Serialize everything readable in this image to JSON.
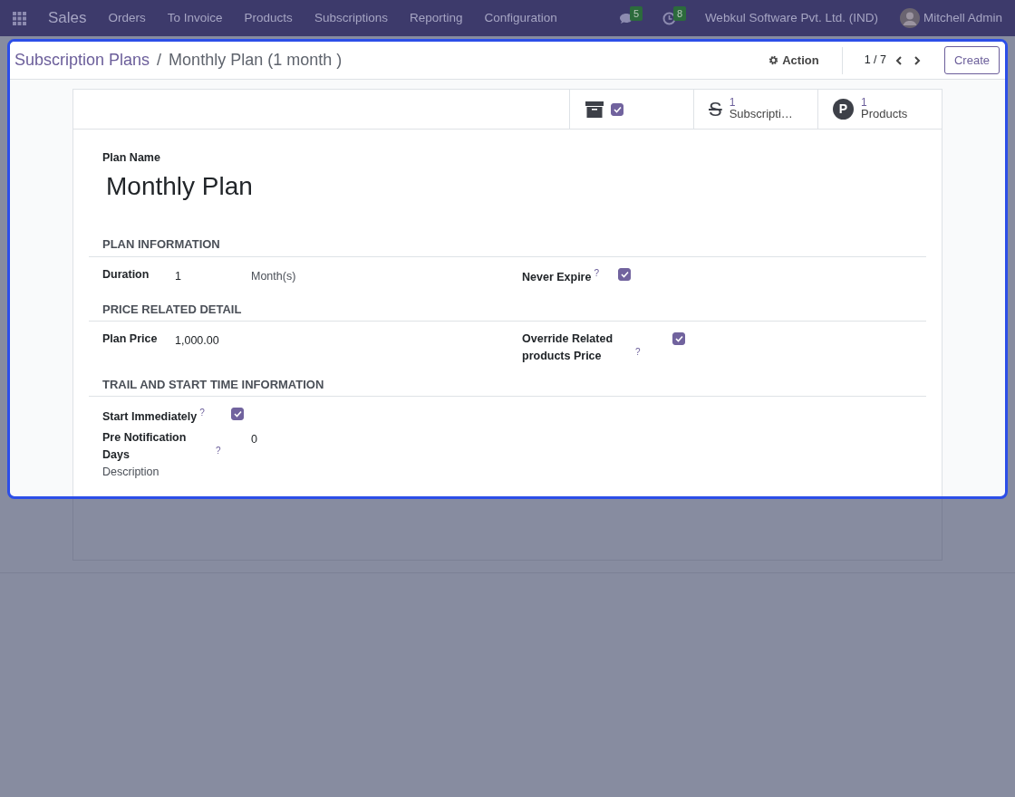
{
  "navbar": {
    "app": "Sales",
    "menu": [
      "Orders",
      "To Invoice",
      "Products",
      "Subscriptions",
      "Reporting",
      "Configuration"
    ],
    "messages_count": "5",
    "activities_count": "8",
    "company": "Webkul Software Pvt. Ltd. (IND)",
    "user": "Mitchell Admin"
  },
  "breadcrumb_separator": "/",
  "breadcrumb": [
    {
      "label": "Subscription Plans"
    },
    {
      "label": "Monthly Plan (1 month )"
    }
  ],
  "action": "Action",
  "pager": "1 / 7",
  "create": "Create",
  "smart_buttons": [
    {
      "kind": "archive",
      "checked": true
    },
    {
      "kind": "stat",
      "icon_text": "S",
      "count": "1",
      "label": "Subscripti…"
    },
    {
      "kind": "stat",
      "icon_text": "P",
      "count": "1",
      "label": "Products"
    }
  ],
  "plan_name_label": "Plan Name",
  "plan_name": "Monthly Plan",
  "sections": [
    {
      "title": "PLAN INFORMATION",
      "left": [
        {
          "kind": "value",
          "label": "Duration",
          "value": "1",
          "unit": "Month(s)"
        }
      ],
      "right": [
        {
          "kind": "checkbox",
          "label": "Never Expire",
          "help": "?",
          "checked": true
        }
      ]
    },
    {
      "title": "PRICE RELATED DETAIL",
      "left": [
        {
          "kind": "value",
          "label": "Plan Price",
          "value": "1,000.00"
        }
      ],
      "right": [
        {
          "kind": "checkbox",
          "label": "Override Related products Price",
          "help": "?",
          "checked": true
        }
      ]
    },
    {
      "title": "TRAIL AND START TIME INFORMATION",
      "left": [
        {
          "kind": "checkbox",
          "label": "Start Immediately",
          "help": "?",
          "checked": true
        },
        {
          "kind": "value",
          "label": "Pre Notification Days",
          "help": "?",
          "value": "0"
        },
        {
          "kind": "caption",
          "label": "Description"
        }
      ]
    }
  ]
}
